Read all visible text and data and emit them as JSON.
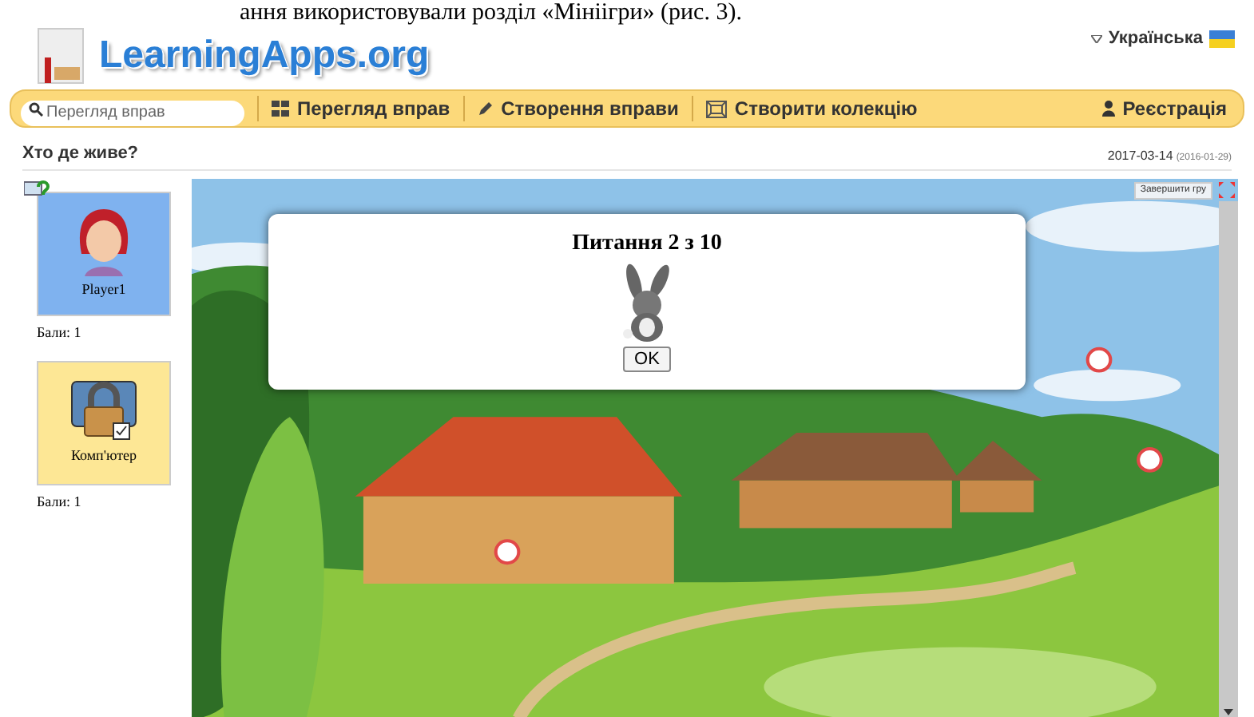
{
  "document_text": "ання використовували розділ «Мініігри» (рис. 3).",
  "language": {
    "label": "Українська"
  },
  "logo": "LearningApps.org",
  "search": {
    "placeholder": "Перегляд вправ"
  },
  "nav": [
    {
      "label": "Перегляд вправ",
      "kind": "grid"
    },
    {
      "label": "Створення вправи",
      "kind": "pencil"
    },
    {
      "label": "Створити колекцію",
      "kind": "collection"
    }
  ],
  "register": "Реєстрація",
  "app_title": "Хто де живе?",
  "date": "2017-03-14",
  "date_created": "(2016-01-29)",
  "players": [
    {
      "name": "Player1",
      "score": "Бали: 1",
      "kind": "human",
      "selected": true
    },
    {
      "name": "Комп'ютер",
      "score": "Бали: 1",
      "kind": "computer",
      "selected": false
    }
  ],
  "end_game": "Завершити гру",
  "dialog": {
    "title": "Питання 2 з 10",
    "button": "OK"
  }
}
